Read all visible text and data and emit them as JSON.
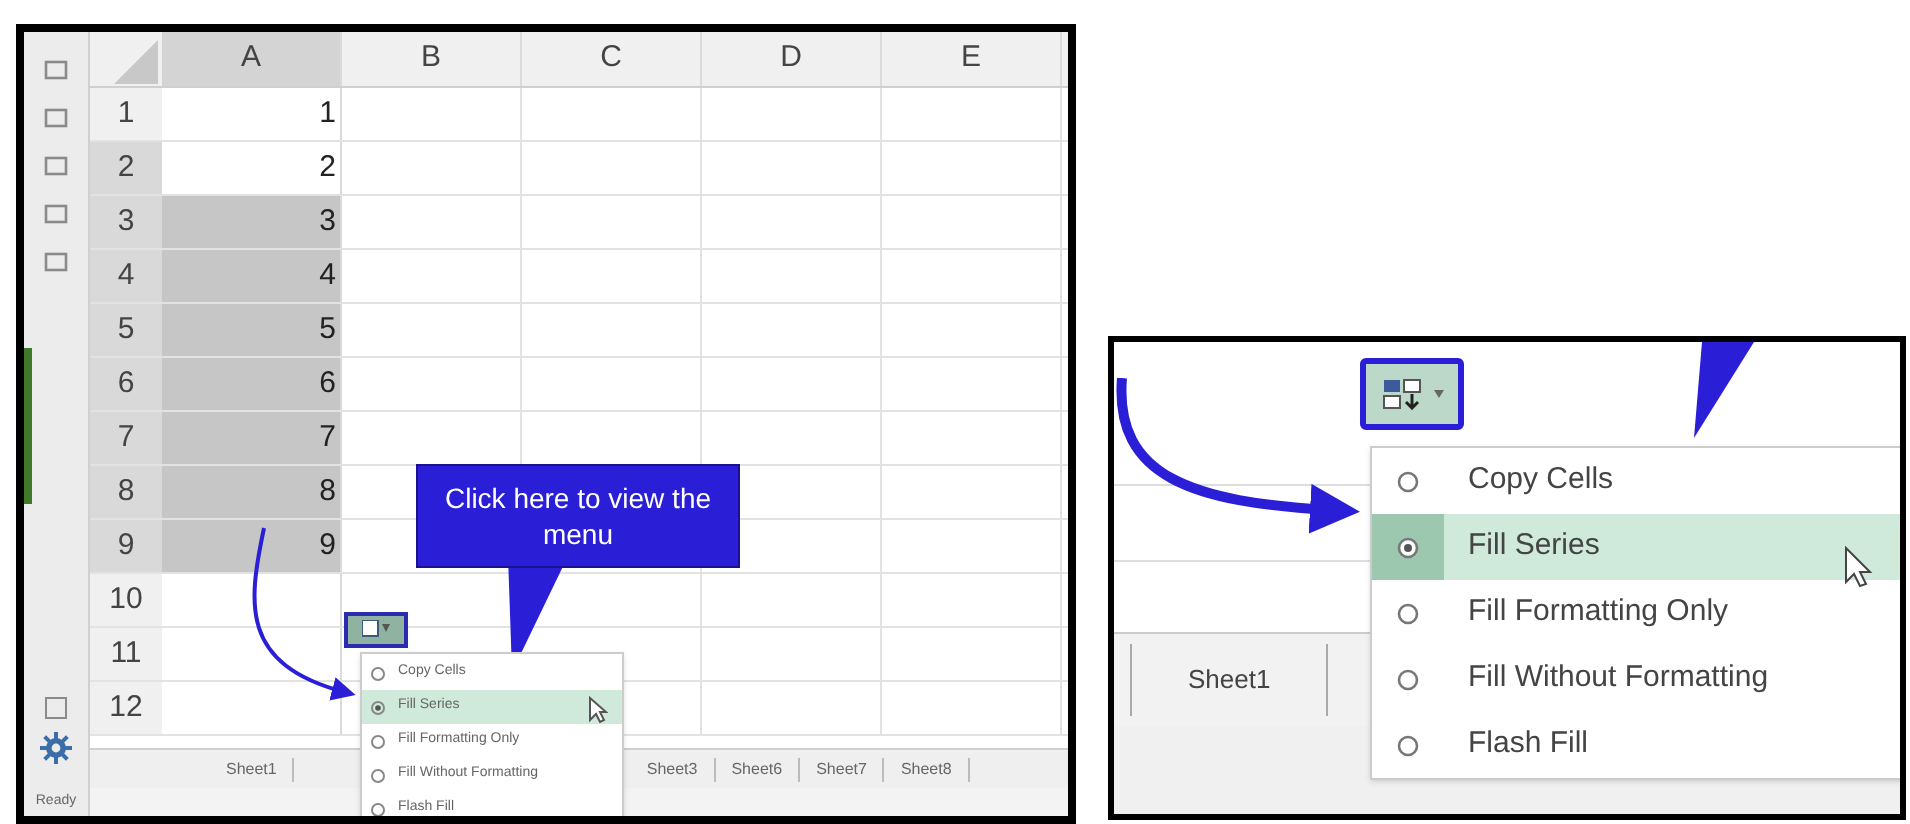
{
  "left_panel": {
    "columns": [
      "A",
      "B",
      "C",
      "D",
      "E"
    ],
    "rows": [
      {
        "header": "1",
        "value": "1",
        "selected": false
      },
      {
        "header": "2",
        "value": "2",
        "selected": false
      },
      {
        "header": "3",
        "value": "3",
        "selected": true
      },
      {
        "header": "4",
        "value": "4",
        "selected": true
      },
      {
        "header": "5",
        "value": "5",
        "selected": true
      },
      {
        "header": "6",
        "value": "6",
        "selected": true
      },
      {
        "header": "7",
        "value": "7",
        "selected": true
      },
      {
        "header": "8",
        "value": "8",
        "selected": true
      },
      {
        "header": "9",
        "value": "9",
        "selected": true
      },
      {
        "header": "10",
        "selected": false
      },
      {
        "header": "11",
        "selected": false
      },
      {
        "header": "12",
        "selected": false
      }
    ],
    "callout": "Click here to view the menu",
    "menu": [
      {
        "label": "Copy Cells",
        "selected": false
      },
      {
        "label": "Fill Series",
        "selected": true
      },
      {
        "label": "Fill Formatting Only",
        "selected": false
      },
      {
        "label": "Fill Without Formatting",
        "selected": false
      },
      {
        "label": "Flash Fill",
        "selected": false
      }
    ],
    "sheet_tabs": [
      "Sheet1",
      "Sheet3",
      "Sheet6",
      "Sheet7",
      "Sheet8"
    ],
    "status": "Ready"
  },
  "right_panel": {
    "menu": [
      {
        "label": "Copy Cells",
        "selected": false
      },
      {
        "label": "Fill Series",
        "selected": true
      },
      {
        "label": "Fill Formatting Only",
        "selected": false
      },
      {
        "label": "Fill Without Formatting",
        "selected": false
      },
      {
        "label": "Flash Fill",
        "selected": false
      }
    ],
    "sheet_tab": "Sheet1"
  }
}
